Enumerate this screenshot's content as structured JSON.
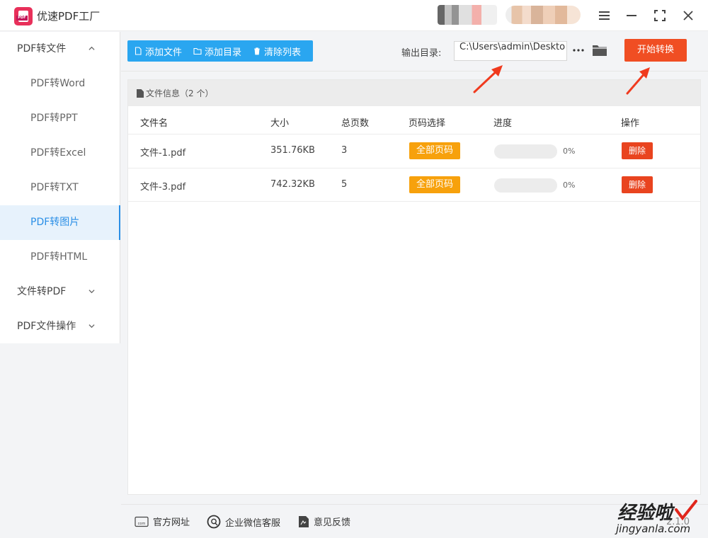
{
  "app": {
    "title": "优速PDF工厂",
    "logo_text": "PDF"
  },
  "sidebar": {
    "items": [
      {
        "label": "PDF转文件",
        "type": "group",
        "expanded": true
      },
      {
        "label": "PDF转Word",
        "type": "sub"
      },
      {
        "label": "PDF转PPT",
        "type": "sub"
      },
      {
        "label": "PDF转Excel",
        "type": "sub"
      },
      {
        "label": "PDF转TXT",
        "type": "sub"
      },
      {
        "label": "PDF转图片",
        "type": "sub",
        "active": true
      },
      {
        "label": "PDF转HTML",
        "type": "sub"
      },
      {
        "label": "文件转PDF",
        "type": "group",
        "expanded": false
      },
      {
        "label": "PDF文件操作",
        "type": "group",
        "expanded": false
      }
    ]
  },
  "toolbar": {
    "add_file": "添加文件",
    "add_dir": "添加目录",
    "clear_list": "清除列表",
    "output_label": "输出目录:",
    "output_path": "C:\\Users\\admin\\Deskto",
    "more": "···",
    "start": "开始转换"
  },
  "file_panel": {
    "header": "文件信息（2 个）",
    "columns": {
      "name": "文件名",
      "size": "大小",
      "pages": "总页数",
      "page_select": "页码选择",
      "progress": "进度",
      "action": "操作"
    },
    "rows": [
      {
        "name": "文件-1.pdf",
        "size": "351.76KB",
        "pages": "3",
        "page_select": "全部页码",
        "progress": 0,
        "progress_text": "0%",
        "action": "删除"
      },
      {
        "name": "文件-3.pdf",
        "size": "742.32KB",
        "pages": "5",
        "page_select": "全部页码",
        "progress": 0,
        "progress_text": "0%",
        "action": "删除"
      }
    ]
  },
  "footer": {
    "website": "官方网址",
    "wechat": "企业微信客服",
    "feedback": "意见反馈",
    "version": "2.1.0"
  },
  "watermark": {
    "title": "经验啦",
    "url": "jingyanla.com"
  },
  "colors": {
    "accent": "#2aa6f0",
    "start": "#f04e23",
    "page_tag": "#f7a10c",
    "delete": "#e9441f",
    "annotation": "#f03a1e"
  }
}
